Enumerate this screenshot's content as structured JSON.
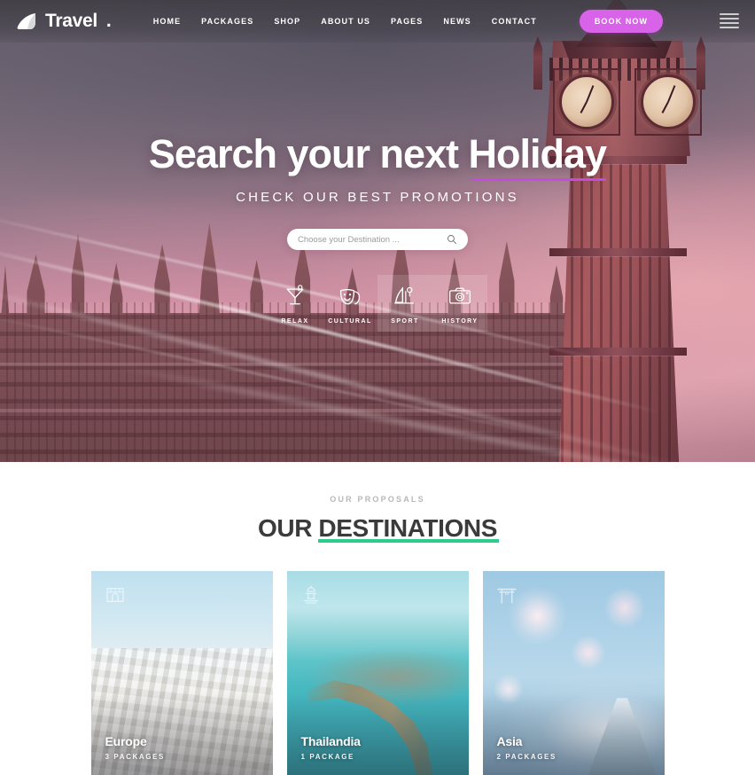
{
  "brand": {
    "name": "Travel",
    "dot": ".",
    "logo_icon": "sail-icon"
  },
  "nav": {
    "items": [
      {
        "label": "HOME"
      },
      {
        "label": "PACKAGES"
      },
      {
        "label": "SHOP"
      },
      {
        "label": "ABOUT US"
      },
      {
        "label": "PAGES"
      },
      {
        "label": "NEWS"
      },
      {
        "label": "CONTACT"
      }
    ],
    "cta_label": "BOOK NOW",
    "cta_color": "#d963e8",
    "menu_toggle_icon": "hamburger-icon"
  },
  "hero": {
    "title_part1": "Search your next ",
    "title_accent": "Holiday",
    "accent_underline_color": "#c44ae0",
    "subtitle": "CHECK OUR BEST PROMOTIONS",
    "search": {
      "placeholder": "Choose your Destination ...",
      "value": "",
      "icon": "search-icon"
    },
    "categories": [
      {
        "label": "RELAX",
        "icon": "cocktail-icon",
        "highlighted": false
      },
      {
        "label": "CULTURAL",
        "icon": "theater-masks-icon",
        "highlighted": false
      },
      {
        "label": "SPORT",
        "icon": "skiing-icon",
        "highlighted": true
      },
      {
        "label": "HISTORY",
        "icon": "camera-icon",
        "highlighted": true
      }
    ]
  },
  "destinations": {
    "eyebrow": "OUR PROPOSALS",
    "title_part1": "OUR ",
    "title_underlined": "DESTINATIONS",
    "underline_color": "#2ecb8e",
    "cards": [
      {
        "name": "Europe",
        "count": "3 PACKAGES",
        "icon": "landmark-icon"
      },
      {
        "name": "Thailandia",
        "count": "1 PACKAGE",
        "icon": "pagoda-icon"
      },
      {
        "name": "Asia",
        "count": "2 PACKAGES",
        "icon": "torii-gate-icon"
      }
    ]
  }
}
